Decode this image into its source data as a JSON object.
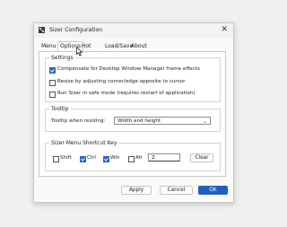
{
  "window": {
    "title": "Sizer Configuration",
    "close_glyph": "✕",
    "app_icon": "sizer-app-icon"
  },
  "tabs": [
    {
      "label": "Menu"
    },
    {
      "label": "Options",
      "active": true
    },
    {
      "label": "Hot Keys"
    },
    {
      "label": "Load/Save"
    },
    {
      "label": "About"
    }
  ],
  "settings": {
    "title": "Settings",
    "options": [
      {
        "label": "Compensate for Desktop Window Manager frame effects",
        "checked": true
      },
      {
        "label": "Resize by adjusting corner/edge opposite to cursor",
        "checked": false
      },
      {
        "label": "Run Sizer in safe mode (requires restart of application)",
        "checked": false
      }
    ]
  },
  "tooltip": {
    "title": "Tooltip",
    "label": "Tooltip when resizing:",
    "selected": "Width and height",
    "chevron": "⌄"
  },
  "shortcut": {
    "title": "Sizer Menu Shortcut Key",
    "modifiers": [
      {
        "label": "Shift",
        "checked": false
      },
      {
        "label": "Ctrl",
        "checked": true
      },
      {
        "label": "Win",
        "checked": true
      },
      {
        "label": "Alt",
        "checked": false
      }
    ],
    "key_value": "Z",
    "clear_label": "Clear"
  },
  "buttons": {
    "apply": "Apply",
    "cancel": "Cancel",
    "ok": "OK"
  },
  "colors": {
    "accent": "#2b65c4",
    "primary_button": "#1f5fc2"
  }
}
